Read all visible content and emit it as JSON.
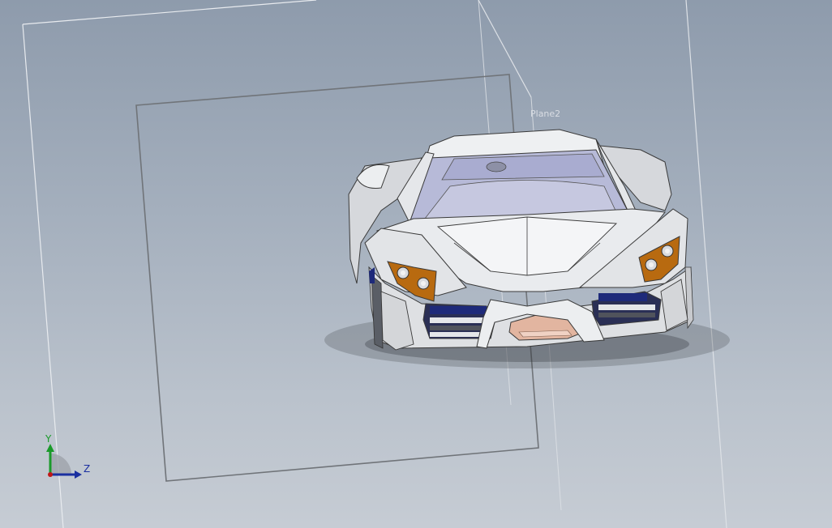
{
  "viewport": {
    "background_top": "#8e9bac",
    "background_bottom": "#c6ccd4"
  },
  "planes": [
    {
      "label": ""
    },
    {
      "label": ""
    },
    {
      "label": "Plane2"
    }
  ],
  "model": {
    "body_color": "#e4e6e9",
    "glass_color": "#b5b8d6",
    "headlight_color": "#b86a10",
    "intake_color": "#1e2a7a",
    "grille_color": "#e2b5a0"
  },
  "triad": {
    "y_label": "Y",
    "z_label": "Z",
    "y_color": "#1a9a2a",
    "z_color": "#1a2fa0",
    "x_color": "#c01818"
  }
}
